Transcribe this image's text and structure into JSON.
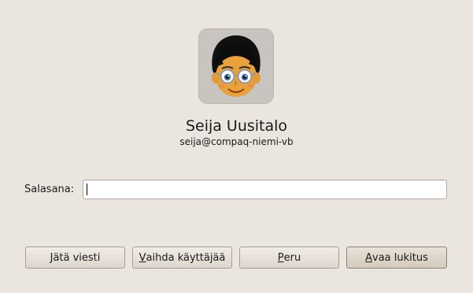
{
  "user": {
    "name": "Seija Uusitalo",
    "host": "seija@compaq-niemi-vb",
    "avatar_icon": "cartoon-face-avatar"
  },
  "password": {
    "label": "Salasana:",
    "value": ""
  },
  "buttons": {
    "leave_message": {
      "mnemonic": "J",
      "rest": "ätä viesti"
    },
    "switch_user": {
      "mnemonic": "V",
      "rest": "aihda käyttäjää"
    },
    "cancel": {
      "mnemonic": "P",
      "rest": "eru"
    },
    "unlock": {
      "mnemonic": "A",
      "rest": "vaa lukitus"
    }
  }
}
